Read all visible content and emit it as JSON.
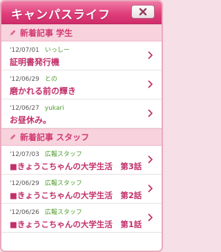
{
  "app": {
    "title": "キャンパスライフ"
  },
  "sections": [
    {
      "label": "新着記事 学生",
      "items": [
        {
          "date": "'12/07/01",
          "author": "いっしー",
          "title": "証明書発行機"
        },
        {
          "date": "'12/06/29",
          "author": "との",
          "title": "磨かれる前の輝き"
        },
        {
          "date": "'12/06/27",
          "author": "yukari",
          "title": "お昼休み。"
        }
      ]
    },
    {
      "label": "新着記事 スタッフ",
      "items": [
        {
          "date": "'12/07/03",
          "author": "広報スタッフ",
          "title": "■きょうこちゃんの大学生活　第3話"
        },
        {
          "date": "'12/06/29",
          "author": "広報スタッフ",
          "title": "■きょうこちゃんの大学生活　第2話"
        },
        {
          "date": "'12/06/26",
          "author": "広報スタッフ",
          "title": "■きょうこちゃんの大学生活　第1話"
        }
      ]
    }
  ],
  "colors": {
    "accent": "#d03b73",
    "header_bg": "#f8d3de",
    "author": "#4a9b2a"
  },
  "icons": {
    "close": "close-icon",
    "section": "pencil-icon",
    "row": "chevron-right-icon"
  }
}
